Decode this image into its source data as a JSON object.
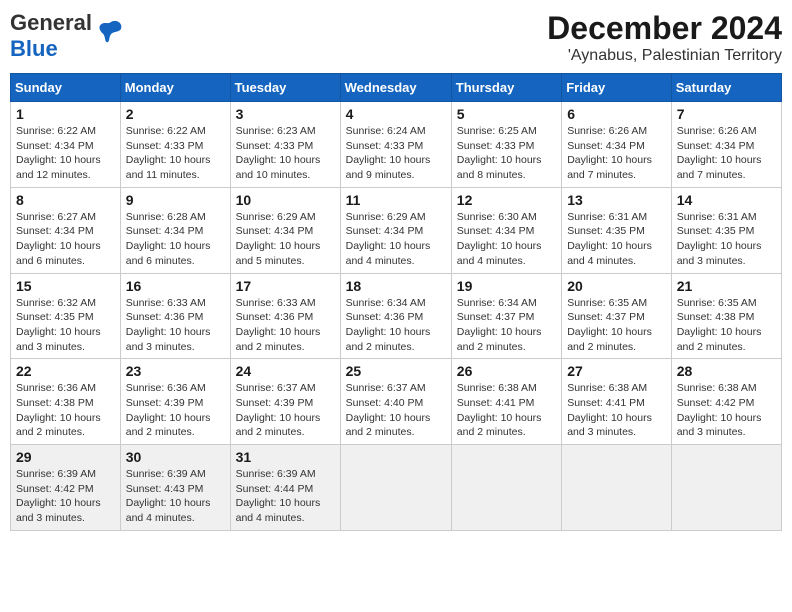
{
  "header": {
    "logo_general": "General",
    "logo_blue": "Blue",
    "title": "December 2024",
    "subtitle": "'Aynabus, Palestinian Territory"
  },
  "calendar": {
    "days_of_week": [
      "Sunday",
      "Monday",
      "Tuesday",
      "Wednesday",
      "Thursday",
      "Friday",
      "Saturday"
    ],
    "weeks": [
      [
        {
          "day": "1",
          "sunrise": "6:22 AM",
          "sunset": "4:34 PM",
          "daylight": "10 hours and 12 minutes."
        },
        {
          "day": "2",
          "sunrise": "6:22 AM",
          "sunset": "4:33 PM",
          "daylight": "10 hours and 11 minutes."
        },
        {
          "day": "3",
          "sunrise": "6:23 AM",
          "sunset": "4:33 PM",
          "daylight": "10 hours and 10 minutes."
        },
        {
          "day": "4",
          "sunrise": "6:24 AM",
          "sunset": "4:33 PM",
          "daylight": "10 hours and 9 minutes."
        },
        {
          "day": "5",
          "sunrise": "6:25 AM",
          "sunset": "4:33 PM",
          "daylight": "10 hours and 8 minutes."
        },
        {
          "day": "6",
          "sunrise": "6:26 AM",
          "sunset": "4:34 PM",
          "daylight": "10 hours and 7 minutes."
        },
        {
          "day": "7",
          "sunrise": "6:26 AM",
          "sunset": "4:34 PM",
          "daylight": "10 hours and 7 minutes."
        }
      ],
      [
        {
          "day": "8",
          "sunrise": "6:27 AM",
          "sunset": "4:34 PM",
          "daylight": "10 hours and 6 minutes."
        },
        {
          "day": "9",
          "sunrise": "6:28 AM",
          "sunset": "4:34 PM",
          "daylight": "10 hours and 6 minutes."
        },
        {
          "day": "10",
          "sunrise": "6:29 AM",
          "sunset": "4:34 PM",
          "daylight": "10 hours and 5 minutes."
        },
        {
          "day": "11",
          "sunrise": "6:29 AM",
          "sunset": "4:34 PM",
          "daylight": "10 hours and 4 minutes."
        },
        {
          "day": "12",
          "sunrise": "6:30 AM",
          "sunset": "4:34 PM",
          "daylight": "10 hours and 4 minutes."
        },
        {
          "day": "13",
          "sunrise": "6:31 AM",
          "sunset": "4:35 PM",
          "daylight": "10 hours and 4 minutes."
        },
        {
          "day": "14",
          "sunrise": "6:31 AM",
          "sunset": "4:35 PM",
          "daylight": "10 hours and 3 minutes."
        }
      ],
      [
        {
          "day": "15",
          "sunrise": "6:32 AM",
          "sunset": "4:35 PM",
          "daylight": "10 hours and 3 minutes."
        },
        {
          "day": "16",
          "sunrise": "6:33 AM",
          "sunset": "4:36 PM",
          "daylight": "10 hours and 3 minutes."
        },
        {
          "day": "17",
          "sunrise": "6:33 AM",
          "sunset": "4:36 PM",
          "daylight": "10 hours and 2 minutes."
        },
        {
          "day": "18",
          "sunrise": "6:34 AM",
          "sunset": "4:36 PM",
          "daylight": "10 hours and 2 minutes."
        },
        {
          "day": "19",
          "sunrise": "6:34 AM",
          "sunset": "4:37 PM",
          "daylight": "10 hours and 2 minutes."
        },
        {
          "day": "20",
          "sunrise": "6:35 AM",
          "sunset": "4:37 PM",
          "daylight": "10 hours and 2 minutes."
        },
        {
          "day": "21",
          "sunrise": "6:35 AM",
          "sunset": "4:38 PM",
          "daylight": "10 hours and 2 minutes."
        }
      ],
      [
        {
          "day": "22",
          "sunrise": "6:36 AM",
          "sunset": "4:38 PM",
          "daylight": "10 hours and 2 minutes."
        },
        {
          "day": "23",
          "sunrise": "6:36 AM",
          "sunset": "4:39 PM",
          "daylight": "10 hours and 2 minutes."
        },
        {
          "day": "24",
          "sunrise": "6:37 AM",
          "sunset": "4:39 PM",
          "daylight": "10 hours and 2 minutes."
        },
        {
          "day": "25",
          "sunrise": "6:37 AM",
          "sunset": "4:40 PM",
          "daylight": "10 hours and 2 minutes."
        },
        {
          "day": "26",
          "sunrise": "6:38 AM",
          "sunset": "4:41 PM",
          "daylight": "10 hours and 2 minutes."
        },
        {
          "day": "27",
          "sunrise": "6:38 AM",
          "sunset": "4:41 PM",
          "daylight": "10 hours and 3 minutes."
        },
        {
          "day": "28",
          "sunrise": "6:38 AM",
          "sunset": "4:42 PM",
          "daylight": "10 hours and 3 minutes."
        }
      ],
      [
        {
          "day": "29",
          "sunrise": "6:39 AM",
          "sunset": "4:42 PM",
          "daylight": "10 hours and 3 minutes."
        },
        {
          "day": "30",
          "sunrise": "6:39 AM",
          "sunset": "4:43 PM",
          "daylight": "10 hours and 4 minutes."
        },
        {
          "day": "31",
          "sunrise": "6:39 AM",
          "sunset": "4:44 PM",
          "daylight": "10 hours and 4 minutes."
        },
        null,
        null,
        null,
        null
      ]
    ]
  }
}
